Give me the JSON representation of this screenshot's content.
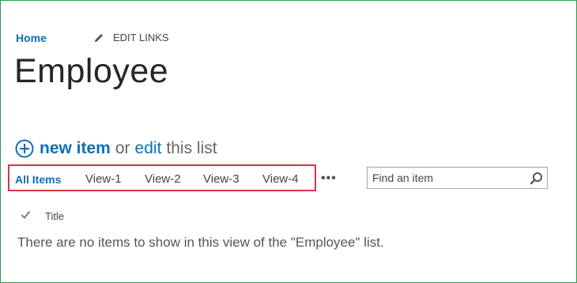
{
  "top_nav": {
    "home_label": "Home",
    "edit_links_label": "EDIT LINKS"
  },
  "page": {
    "title": "Employee"
  },
  "new_item_row": {
    "new_item_label": "new item",
    "or_text": "or",
    "edit_label": "edit",
    "this_list_text": "this list"
  },
  "views": {
    "tabs": [
      {
        "label": "All Items",
        "selected": true
      },
      {
        "label": "View-1",
        "selected": false
      },
      {
        "label": "View-2",
        "selected": false
      },
      {
        "label": "View-3",
        "selected": false
      },
      {
        "label": "View-4",
        "selected": false
      }
    ],
    "more_label": "•••"
  },
  "search": {
    "placeholder": "Find an item",
    "value": ""
  },
  "list": {
    "columns": [
      "Title"
    ],
    "empty_message": "There are no items to show in this view of the \"Employee\" list."
  },
  "colors": {
    "link_blue": "#0e6fba",
    "highlight_red": "#d9363e",
    "frame_green": "#2f9e4d"
  },
  "icons": {
    "pencil": "pencil-icon",
    "add": "plus-circle-icon",
    "search": "search-icon",
    "select_all": "checkmark-icon"
  }
}
